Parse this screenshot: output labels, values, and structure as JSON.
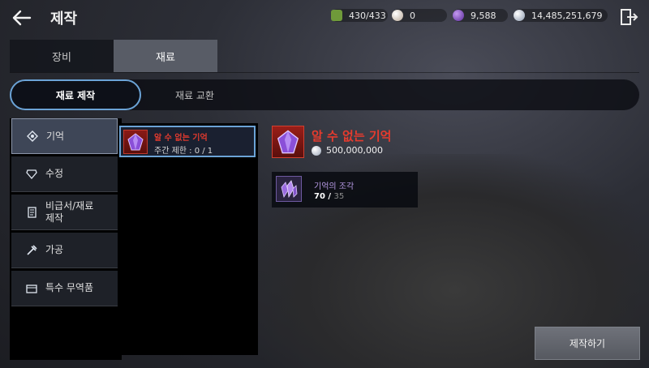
{
  "header": {
    "back_icon": "arrow-left-icon",
    "title": "제작",
    "exit_icon": "exit-door-icon"
  },
  "currencies": [
    {
      "icon": "green-shield-icon",
      "value": "430/433",
      "color": "#6f9a3a"
    },
    {
      "icon": "pearl-icon",
      "value": "0",
      "color": "#d8c9b8"
    },
    {
      "icon": "purple-orb-icon",
      "value": "9,588",
      "color": "#7b3fc4"
    },
    {
      "icon": "silver-coin-icon",
      "value": "14,485,251,679",
      "color": "#b8c2d2"
    }
  ],
  "tabs": [
    {
      "label": "장비",
      "active": false
    },
    {
      "label": "재료",
      "active": true
    }
  ],
  "subtabs": [
    {
      "label": "재료 제작",
      "active": true
    },
    {
      "label": "재료 교환",
      "active": false
    }
  ],
  "categories": [
    {
      "icon": "memory-icon",
      "label": "기억",
      "active": true
    },
    {
      "icon": "crystal-icon",
      "label": "수정",
      "active": false
    },
    {
      "icon": "scroll-icon",
      "label": "비급서/재료\n제작",
      "active": false
    },
    {
      "icon": "hammer-icon",
      "label": "가공",
      "active": false
    },
    {
      "icon": "trade-goods-icon",
      "label": "특수 무역품",
      "active": false
    }
  ],
  "item_list": [
    {
      "name": "알 수 없는 기억",
      "limit": "주간 제한 : 0 / 1",
      "selected": true
    }
  ],
  "detail": {
    "name": "알 수 없는 기억",
    "cost": "500,000,000",
    "materials": [
      {
        "name": "기억의 조각",
        "owned": "70",
        "separator": " / ",
        "required": "35"
      }
    ]
  },
  "craft_button": {
    "label": "제작하기"
  },
  "colors": {
    "accent_blue": "#6ba3d6",
    "item_red": "#e53b2e",
    "material_purple": "#b99ce8"
  }
}
